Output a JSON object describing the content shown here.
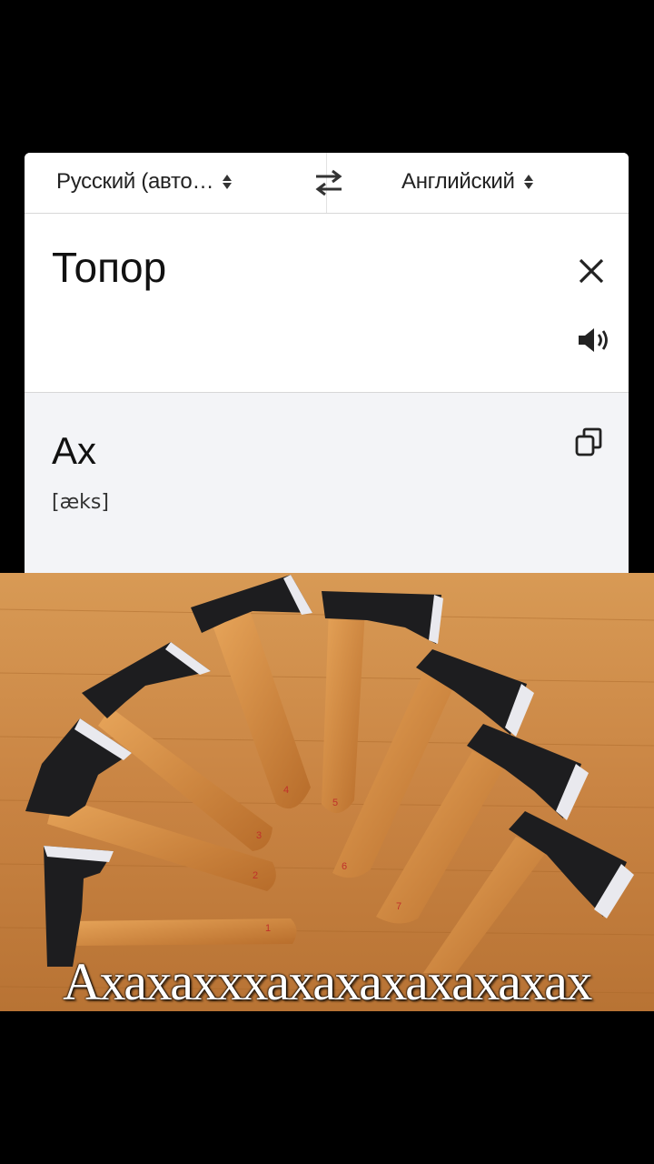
{
  "translator": {
    "source_language": "Русский (авто…",
    "target_language": "Английский",
    "source_text": "Топор",
    "translation": "Ax",
    "transcription": "[æks]"
  },
  "icons": {
    "source_dropdown": "updown-arrows-icon",
    "swap": "swap-languages-icon",
    "target_dropdown": "updown-arrows-icon",
    "clear": "close-icon",
    "speaker": "speaker-icon",
    "copy": "copy-icon"
  },
  "photo": {
    "description_subject": "axes",
    "caption": "Ахахахххахахахахахахах",
    "handle_numbers": [
      "1",
      "2",
      "3",
      "4",
      "5",
      "6",
      "7"
    ]
  },
  "colors": {
    "background": "#000000",
    "panel": "#ffffff",
    "result_panel": "#f3f4f7",
    "wood_floor": "#c98a45"
  }
}
